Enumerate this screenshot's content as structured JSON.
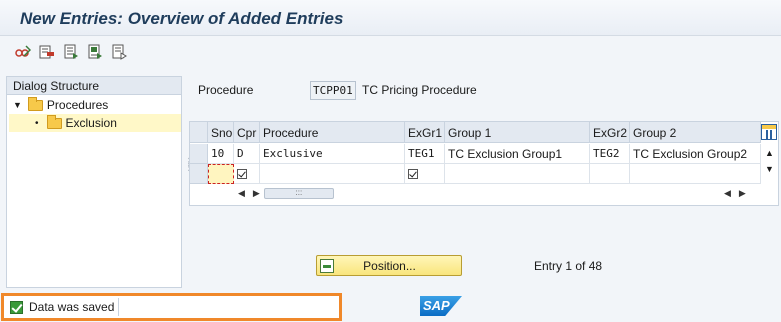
{
  "window": {
    "title": "New Entries: Overview of Added Entries"
  },
  "toolbar": {
    "buttons": [
      {
        "icon": "glasses-pen-icon",
        "color": "#c0392b"
      },
      {
        "icon": "delete-row-icon",
        "color": "#c0392b"
      },
      {
        "icon": "select-all-icon",
        "color": "#3a7a3a"
      },
      {
        "icon": "select-block-icon",
        "color": "#3a7a3a"
      },
      {
        "icon": "deselect-all-icon",
        "color": "#6a6a6a"
      }
    ]
  },
  "dialog_structure": {
    "header": "Dialog Structure",
    "items": [
      {
        "label": "Procedures",
        "expanded": true,
        "selected": false
      },
      {
        "label": "Exclusion",
        "expanded": false,
        "selected": true
      }
    ]
  },
  "procedure": {
    "label": "Procedure",
    "value": "TCPP01",
    "description": "TC Pricing Procedure"
  },
  "table": {
    "columns": [
      "Sno",
      "Cpr",
      "Procedure",
      "ExGr1",
      "Group 1",
      "ExGr2",
      "Group 2"
    ],
    "rows": [
      {
        "sno": "10",
        "cpr": "D",
        "procedure": "Exclusive",
        "exgr1": "TEG1",
        "group1": "TC Exclusion Group1",
        "exgr2": "TEG2",
        "group2": "TC Exclusion Group2"
      }
    ],
    "new_row": {
      "cpr_checked": true,
      "exgr1_checked": true
    }
  },
  "position_button": {
    "label": "Position..."
  },
  "entry_info": "Entry 1 of 48",
  "status": {
    "message": "Data was saved",
    "type": "success"
  },
  "brand": {
    "logo_text": "SAP",
    "accent": "#f0882a"
  }
}
